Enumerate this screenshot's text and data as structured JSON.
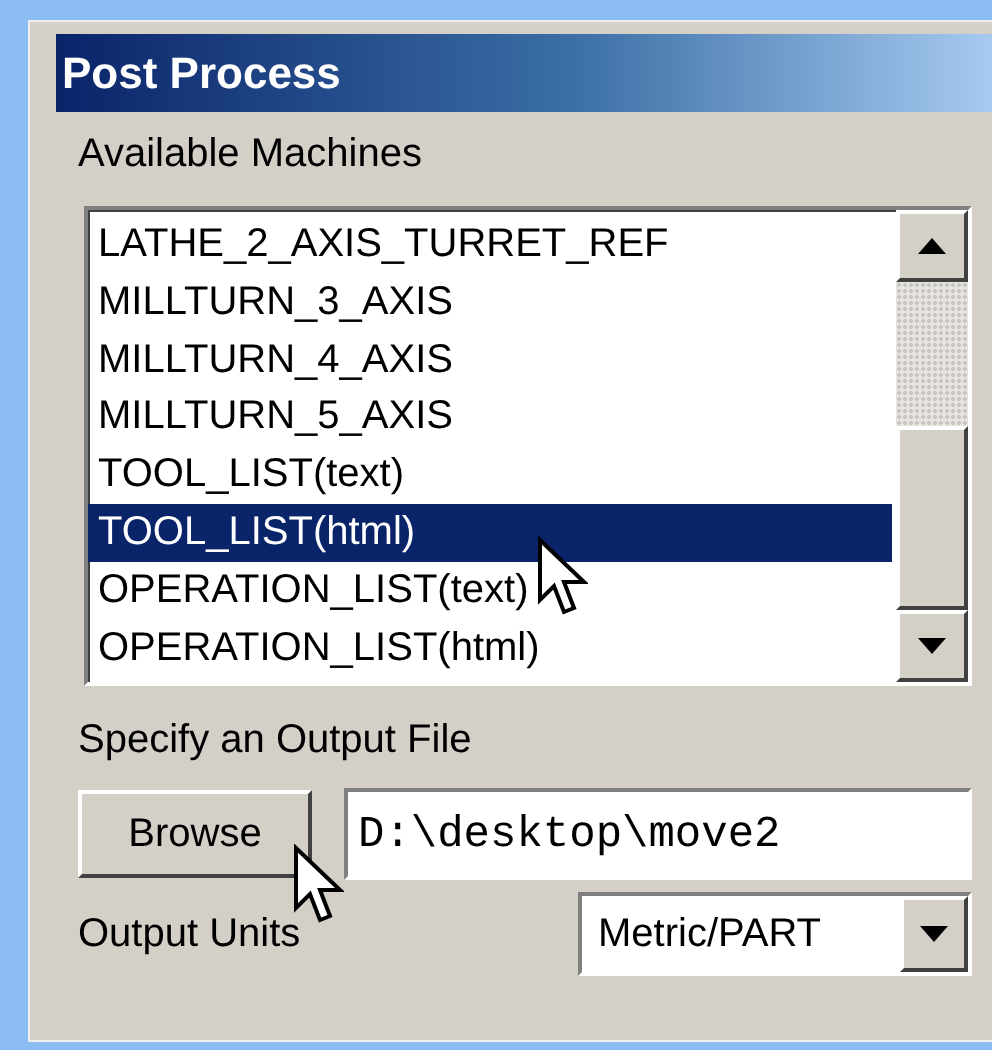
{
  "window": {
    "title": "Post Process"
  },
  "machines": {
    "label": "Available Machines",
    "items": [
      {
        "label": "LATHE_2_AXIS_TURRET_REF",
        "selected": false
      },
      {
        "label": "MILLTURN_3_AXIS",
        "selected": false
      },
      {
        "label": "MILLTURN_4_AXIS",
        "selected": false
      },
      {
        "label": "MILLTURN_5_AXIS",
        "selected": false
      },
      {
        "label": "TOOL_LIST(text)",
        "selected": false
      },
      {
        "label": "TOOL_LIST(html)",
        "selected": true
      },
      {
        "label": "OPERATION_LIST(text)",
        "selected": false
      },
      {
        "label": "OPERATION_LIST(html)",
        "selected": false
      }
    ]
  },
  "output_file": {
    "label": "Specify an Output File",
    "button": "Browse",
    "value": "D:\\desktop\\move2"
  },
  "output_units": {
    "label": "Output Units",
    "value": "Metric/PART"
  }
}
